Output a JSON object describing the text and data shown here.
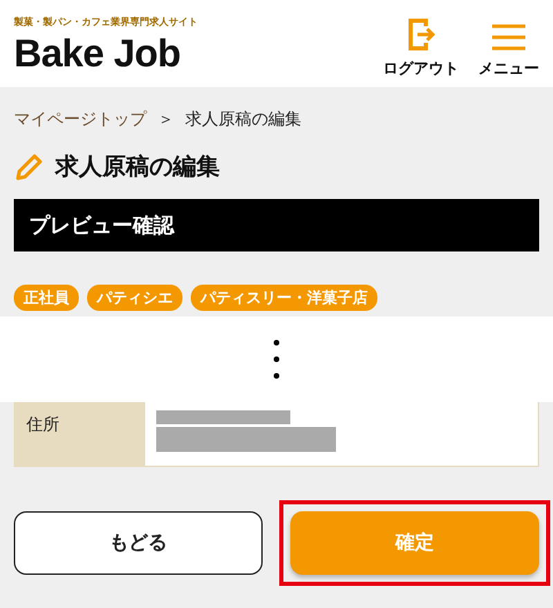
{
  "header": {
    "tagline": "製菓・製パン・カフェ業界専門求人サイト",
    "logo": "Bake Job",
    "actions": [
      {
        "kind": "logout",
        "label": "ログアウト"
      },
      {
        "kind": "menu",
        "label": "メニュー"
      }
    ]
  },
  "breadcrumb": {
    "separator": "＞",
    "items": [
      {
        "label": "マイページトップ",
        "link": true
      },
      {
        "label": "求人原稿の編集",
        "link": false
      }
    ]
  },
  "page_title": "求人原稿の編集",
  "section_title": "プレビュー確認",
  "tags": [
    "正社員",
    "パティシエ",
    "パティスリー・洋菓子店"
  ],
  "details": [
    {
      "label": "住所",
      "redacted": true
    }
  ],
  "buttons": [
    {
      "kind": "secondary",
      "label": "もどる",
      "highlighted": false
    },
    {
      "kind": "primary",
      "label": "確定",
      "highlighted": true
    }
  ]
}
